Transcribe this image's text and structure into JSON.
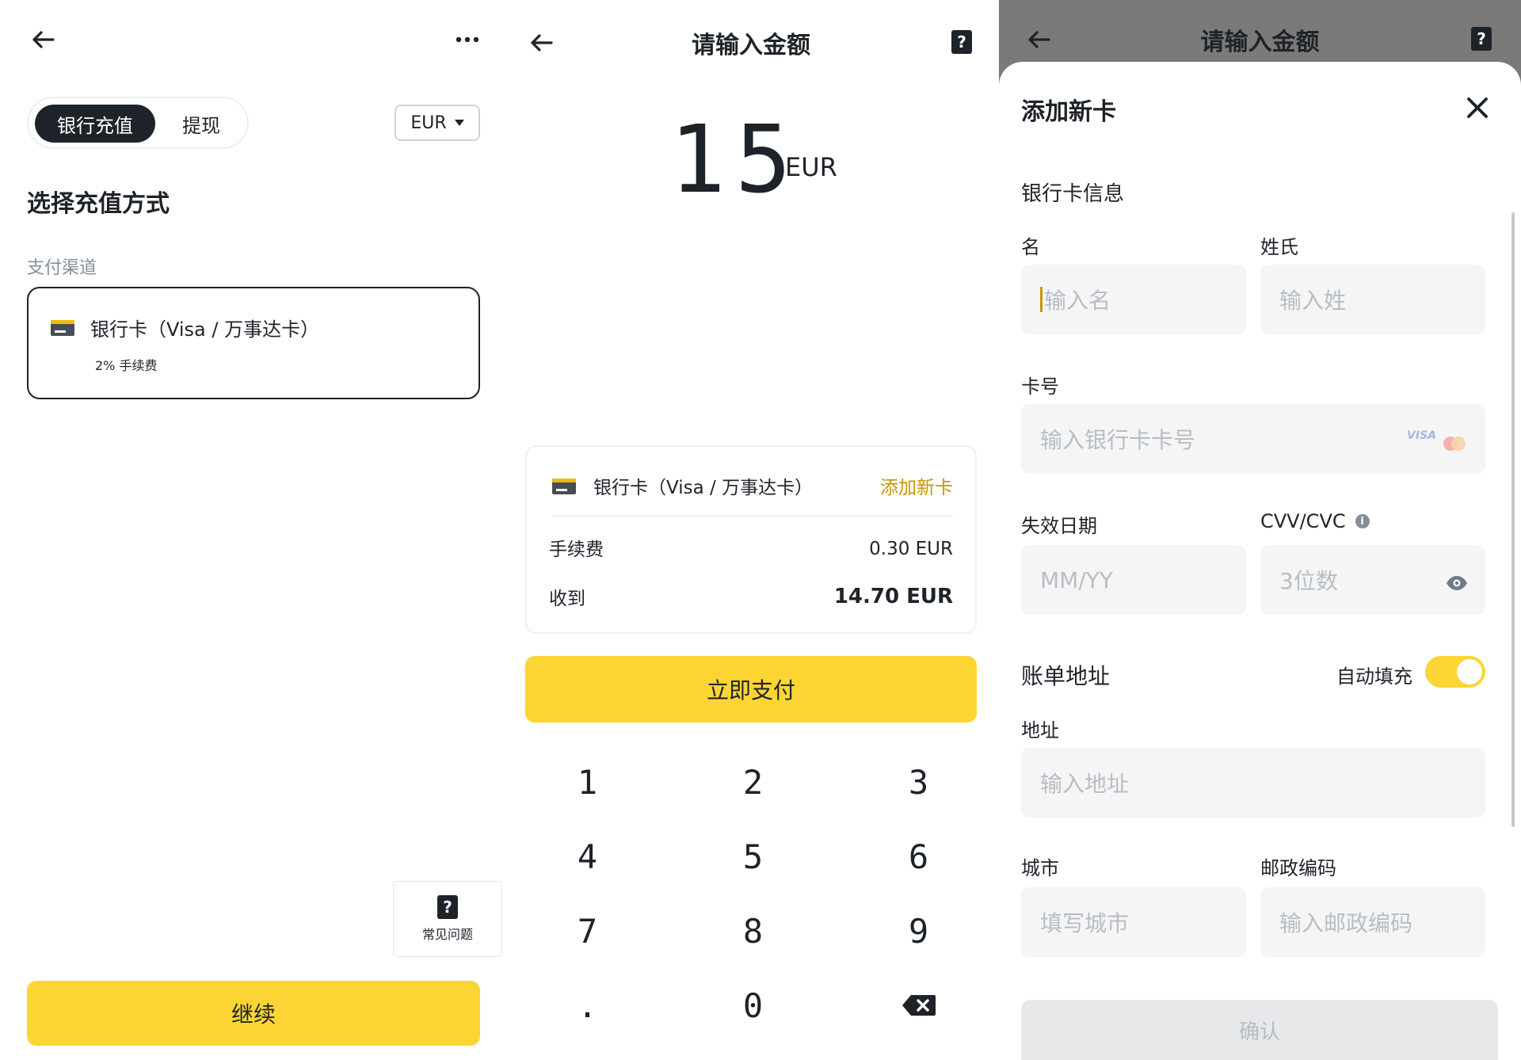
{
  "colors": {
    "accent": "#fcd535",
    "dark": "#1e2329",
    "link": "#c99400",
    "placeholder": "#b7bdc6",
    "overlay": "#7a7a7a"
  },
  "panel1": {
    "tabs": [
      {
        "label": "银行充值",
        "active": true
      },
      {
        "label": "提现",
        "active": false
      }
    ],
    "currency": "EUR",
    "heading": "选择充值方式",
    "section_label": "支付渠道",
    "method": {
      "name": "银行卡（Visa / 万事达卡）",
      "fee": "2% 手续费"
    },
    "faq_label": "常见问题",
    "continue_label": "继续"
  },
  "panel2": {
    "title": "请输入金额",
    "amount": "15",
    "amount_currency": "EUR",
    "method_name": "银行卡（Visa / 万事达卡）",
    "add_card_label": "添加新卡",
    "fee_label": "手续费",
    "fee_value": "0.30 EUR",
    "receive_label": "收到",
    "receive_value": "14.70 EUR",
    "pay_label": "立即支付",
    "keypad": [
      "1",
      "2",
      "3",
      "4",
      "5",
      "6",
      "7",
      "8",
      "9",
      ".",
      "0",
      "backspace"
    ]
  },
  "panel3": {
    "title": "请输入金额",
    "sheet_title": "添加新卡",
    "section": "银行卡信息",
    "first_name": {
      "label": "名",
      "placeholder": "输入名"
    },
    "last_name": {
      "label": "姓氏",
      "placeholder": "输入姓"
    },
    "card_number": {
      "label": "卡号",
      "placeholder": "输入银行卡卡号",
      "brand": "VISA"
    },
    "expiry": {
      "label": "失效日期",
      "placeholder": "MM/YY"
    },
    "cvv": {
      "label": "CVV/CVC",
      "placeholder": "3位数"
    },
    "billing": {
      "label": "账单地址",
      "autofill_label": "自动填充",
      "autofill_on": true
    },
    "address": {
      "label": "地址",
      "placeholder": "输入地址"
    },
    "city": {
      "label": "城市",
      "placeholder": "填写城市"
    },
    "postal": {
      "label": "邮政编码",
      "placeholder": "输入邮政编码"
    },
    "confirm_label": "确认"
  }
}
